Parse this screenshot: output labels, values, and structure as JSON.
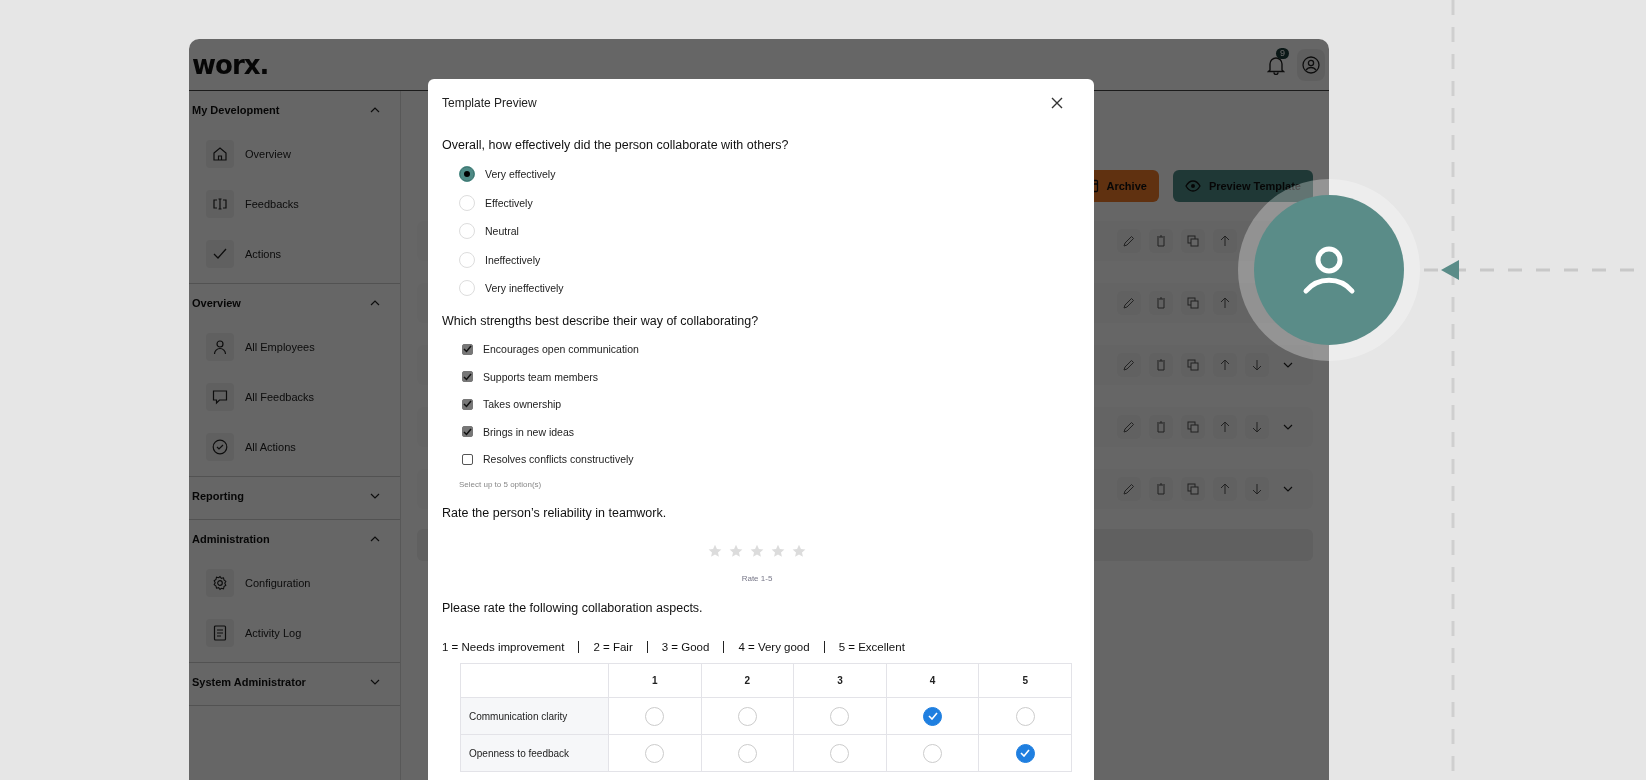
{
  "app": {
    "logo": "worx.",
    "notification_count": "9"
  },
  "sidebar": {
    "sections": [
      {
        "title": "My Development",
        "expanded": true,
        "items": [
          {
            "label": "Overview",
            "kind": "home"
          },
          {
            "label": "Feedbacks",
            "kind": "feedback"
          },
          {
            "label": "Actions",
            "kind": "check"
          }
        ]
      },
      {
        "title": "Overview",
        "expanded": true,
        "items": [
          {
            "label": "All Employees",
            "kind": "person"
          },
          {
            "label": "All Feedbacks",
            "kind": "chat"
          },
          {
            "label": "All Actions",
            "kind": "circle-check"
          }
        ]
      },
      {
        "title": "Reporting",
        "expanded": false
      },
      {
        "title": "Administration",
        "expanded": true,
        "items": [
          {
            "label": "Configuration",
            "kind": "gear"
          },
          {
            "label": "Activity Log",
            "kind": "log"
          }
        ]
      },
      {
        "title": "System Administrator",
        "expanded": false
      }
    ]
  },
  "toolbar": {
    "buttons": [
      {
        "label": "Archive",
        "kind": "archive"
      },
      {
        "label": "Preview Template",
        "kind": "preview"
      }
    ]
  },
  "modal": {
    "title": "Template Preview",
    "questions": [
      {
        "kind": "radio",
        "prompt": "Overall, how effectively did the person collaborate with others?",
        "options": [
          {
            "label": "Very effectively",
            "selected": true
          },
          {
            "label": "Effectively",
            "selected": false
          },
          {
            "label": "Neutral",
            "selected": false
          },
          {
            "label": "Ineffectively",
            "selected": false
          },
          {
            "label": "Very ineffectively",
            "selected": false
          }
        ]
      },
      {
        "kind": "checkbox",
        "prompt": "Which strengths best describe their way of collaborating?",
        "options": [
          {
            "label": "Encourages open communication",
            "checked": true
          },
          {
            "label": "Supports team members",
            "checked": true
          },
          {
            "label": "Takes ownership",
            "checked": true
          },
          {
            "label": "Brings in new ideas",
            "checked": true
          },
          {
            "label": "Resolves conflicts constructively",
            "checked": false
          }
        ],
        "hint": "Select up to 5 option(s)"
      },
      {
        "kind": "stars",
        "prompt": "Rate the person’s reliability in teamwork.",
        "stars": 0,
        "hint": "Rate 1-5"
      },
      {
        "kind": "matrix",
        "prompt": "Please rate the following collaboration aspects.",
        "legend": [
          "1 = Needs improvement",
          "2 = Fair",
          "3 = Good",
          "4 = Very good",
          "5 = Excellent"
        ],
        "columns": [
          "1",
          "2",
          "3",
          "4",
          "5"
        ],
        "rows": [
          {
            "label": "Communication clarity",
            "cells": [
              {
                "selected": false
              },
              {
                "selected": false
              },
              {
                "selected": false
              },
              {
                "selected": true
              },
              {
                "selected": false
              }
            ]
          },
          {
            "label": "Openness to feedback",
            "cells": [
              {
                "selected": false
              },
              {
                "selected": false
              },
              {
                "selected": false
              },
              {
                "selected": false
              },
              {
                "selected": true
              }
            ]
          }
        ]
      }
    ]
  }
}
